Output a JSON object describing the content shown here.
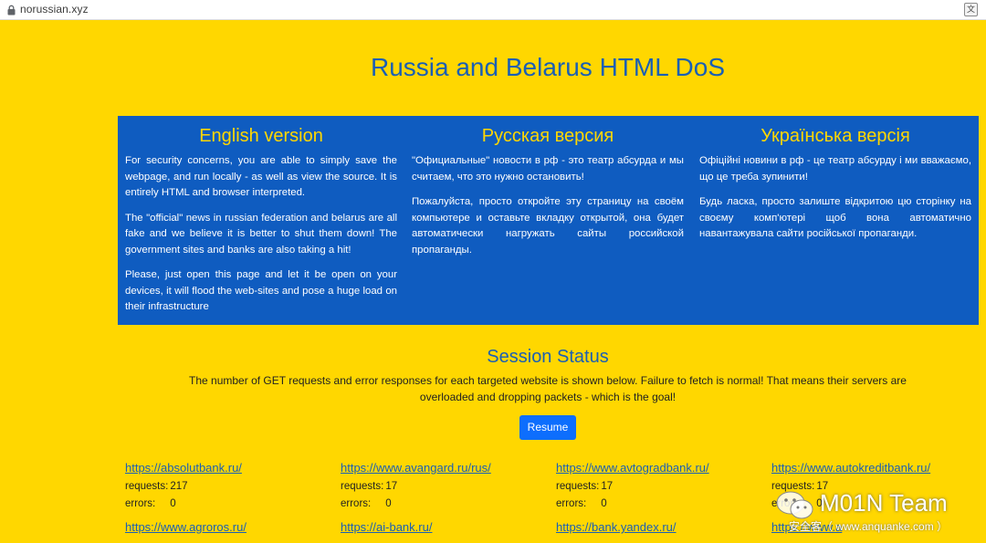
{
  "browser": {
    "url": "norussian.xyz",
    "translate_label": "文"
  },
  "title": "Russia and Belarus HTML DoS",
  "panel": {
    "english": {
      "heading": "English version",
      "p1": "For security concerns, you are able to simply save the webpage, and run locally - as well as view the source. It is entirely HTML and browser interpreted.",
      "p2": "The \"official\" news in russian federation and belarus are all fake and we believe it is better to shut them down! The government sites and banks are also taking a hit!",
      "p3": "Please, just open this page and let it be open on your devices, it will flood the web-sites and pose a huge load on their infrastructure"
    },
    "russian": {
      "heading": "Русская версия",
      "p1": "\"Официальные\" новости в рф - это театр абсурда и мы считаем, что это нужно остановить!",
      "p2": "Пожалуйста, просто откройте эту страницу на своём компьютере и оставьте вкладку открытой, она будет автоматически нагружать сайты российской пропаганды."
    },
    "ukrainian": {
      "heading": "Українська версія",
      "p1": "Офіційні новини в рф - це театр абсурду і ми вважаємо, що це треба зупинити!",
      "p2": "Будь ласка, просто залиште відкритою цю сторінку на своєму комп'ютері щоб вона автоматично навантажувала сайти російської пропаганди."
    }
  },
  "session": {
    "title": "Session Status",
    "description": "The number of GET requests and error responses for each targeted website is shown below. Failure to fetch is normal! That means their servers are overloaded and dropping packets - which is the goal!",
    "resume_label": "Resume",
    "requests_label": "requests:",
    "errors_label": "errors:",
    "sites": [
      {
        "url": "https://absolutbank.ru/",
        "requests": "217",
        "errors": "0"
      },
      {
        "url": "https://www.avangard.ru/rus/",
        "requests": "17",
        "errors": "0"
      },
      {
        "url": "https://www.avtogradbank.ru/",
        "requests": "17",
        "errors": "0"
      },
      {
        "url": "https://www.autokreditbank.ru/",
        "requests": "17",
        "errors": "0"
      },
      {
        "url": "https://www.agroros.ru/"
      },
      {
        "url": "https://ai-bank.ru/"
      },
      {
        "url": "https://bank.yandex.ru/"
      },
      {
        "url": "https://www.a"
      }
    ]
  },
  "watermark": {
    "team": "M01N Team",
    "sub": "安全客（ www.anquanke.com ）"
  }
}
